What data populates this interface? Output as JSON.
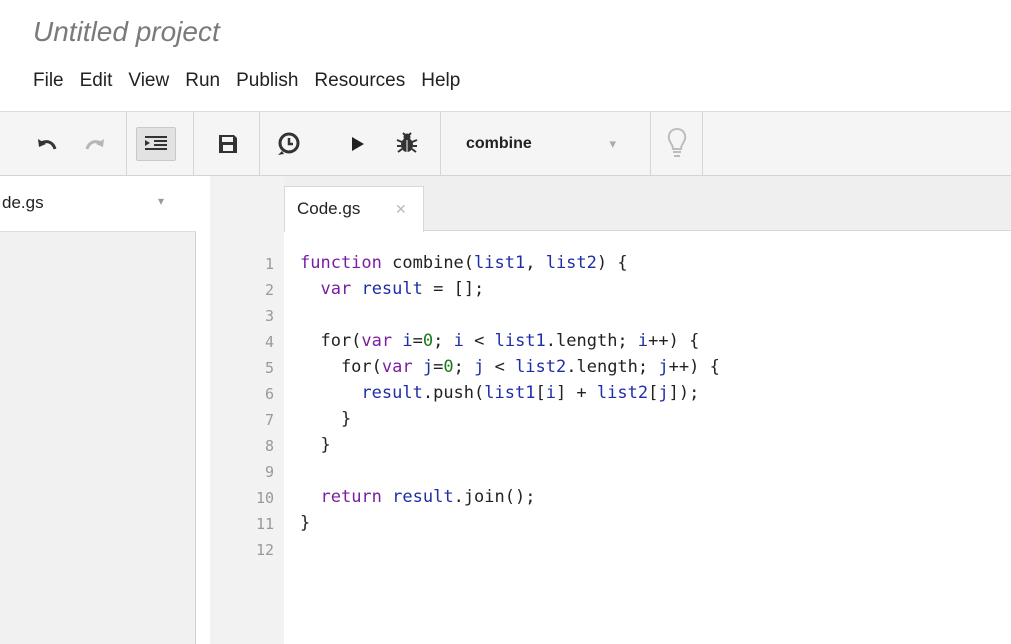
{
  "app": {
    "project_title": "Untitled project"
  },
  "menu": [
    "File",
    "Edit",
    "View",
    "Run",
    "Publish",
    "Resources",
    "Help"
  ],
  "toolbar": {
    "buttons": [
      {
        "name": "undo-button",
        "icon": "undo-icon",
        "enabled": true
      },
      {
        "name": "redo-button",
        "icon": "redo-icon",
        "enabled": false
      },
      {
        "name": "indent-button",
        "icon": "indent-icon",
        "enabled": true,
        "active": true
      },
      {
        "name": "save-button",
        "icon": "save-icon",
        "enabled": true
      },
      {
        "name": "triggers-button",
        "icon": "clock-icon",
        "enabled": true
      },
      {
        "name": "run-button",
        "icon": "play-icon",
        "enabled": true
      },
      {
        "name": "debug-button",
        "icon": "bug-icon",
        "enabled": true
      },
      {
        "name": "hint-button",
        "icon": "lightbulb-icon",
        "enabled": false
      }
    ],
    "selected_function": "combine"
  },
  "sidebar": {
    "files": [
      {
        "label": "de.gs"
      }
    ]
  },
  "editor": {
    "tab": {
      "label": "Code.gs",
      "close_icon": "close-icon"
    },
    "lines": [
      {
        "n": "1",
        "tokens": [
          [
            "kw",
            "function"
          ],
          [
            "t",
            " "
          ],
          [
            "t",
            "combine("
          ],
          [
            "id",
            "list1"
          ],
          [
            "t",
            ", "
          ],
          [
            "id",
            "list2"
          ],
          [
            "t",
            ") {"
          ]
        ]
      },
      {
        "n": "2",
        "tokens": [
          [
            "t",
            "  "
          ],
          [
            "kw",
            "var"
          ],
          [
            "t",
            " "
          ],
          [
            "id",
            "result"
          ],
          [
            "t",
            " = [];"
          ]
        ]
      },
      {
        "n": "3",
        "tokens": []
      },
      {
        "n": "4",
        "tokens": [
          [
            "t",
            "  for("
          ],
          [
            "kw",
            "var"
          ],
          [
            "t",
            " "
          ],
          [
            "id",
            "i"
          ],
          [
            "t",
            "="
          ],
          [
            "num",
            "0"
          ],
          [
            "t",
            "; "
          ],
          [
            "id",
            "i"
          ],
          [
            "t",
            " < "
          ],
          [
            "id",
            "list1"
          ],
          [
            "t",
            ".length; "
          ],
          [
            "id",
            "i"
          ],
          [
            "t",
            "++) {"
          ]
        ]
      },
      {
        "n": "5",
        "tokens": [
          [
            "t",
            "    for("
          ],
          [
            "kw",
            "var"
          ],
          [
            "t",
            " "
          ],
          [
            "id",
            "j"
          ],
          [
            "t",
            "="
          ],
          [
            "num",
            "0"
          ],
          [
            "t",
            "; "
          ],
          [
            "id",
            "j"
          ],
          [
            "t",
            " < "
          ],
          [
            "id",
            "list2"
          ],
          [
            "t",
            ".length; "
          ],
          [
            "id",
            "j"
          ],
          [
            "t",
            "++) {"
          ]
        ]
      },
      {
        "n": "6",
        "tokens": [
          [
            "t",
            "      "
          ],
          [
            "id",
            "result"
          ],
          [
            "t",
            ".push("
          ],
          [
            "id",
            "list1"
          ],
          [
            "t",
            "["
          ],
          [
            "id",
            "i"
          ],
          [
            "t",
            "] + "
          ],
          [
            "id",
            "list2"
          ],
          [
            "t",
            "["
          ],
          [
            "id",
            "j"
          ],
          [
            "t",
            "]);"
          ]
        ]
      },
      {
        "n": "7",
        "tokens": [
          [
            "t",
            "    }"
          ]
        ]
      },
      {
        "n": "8",
        "tokens": [
          [
            "t",
            "  }"
          ]
        ]
      },
      {
        "n": "9",
        "tokens": []
      },
      {
        "n": "10",
        "tokens": [
          [
            "t",
            "  "
          ],
          [
            "kw",
            "return"
          ],
          [
            "t",
            " "
          ],
          [
            "id",
            "result"
          ],
          [
            "t",
            ".join();"
          ]
        ]
      },
      {
        "n": "11",
        "tokens": [
          [
            "t",
            "}"
          ]
        ]
      },
      {
        "n": "12",
        "tokens": []
      }
    ]
  },
  "colors": {
    "keyword": "#7a1fa2",
    "identifier": "#1e2ea8",
    "number": "#1b7a1b",
    "toolbar_bg": "#f5f5f5"
  }
}
